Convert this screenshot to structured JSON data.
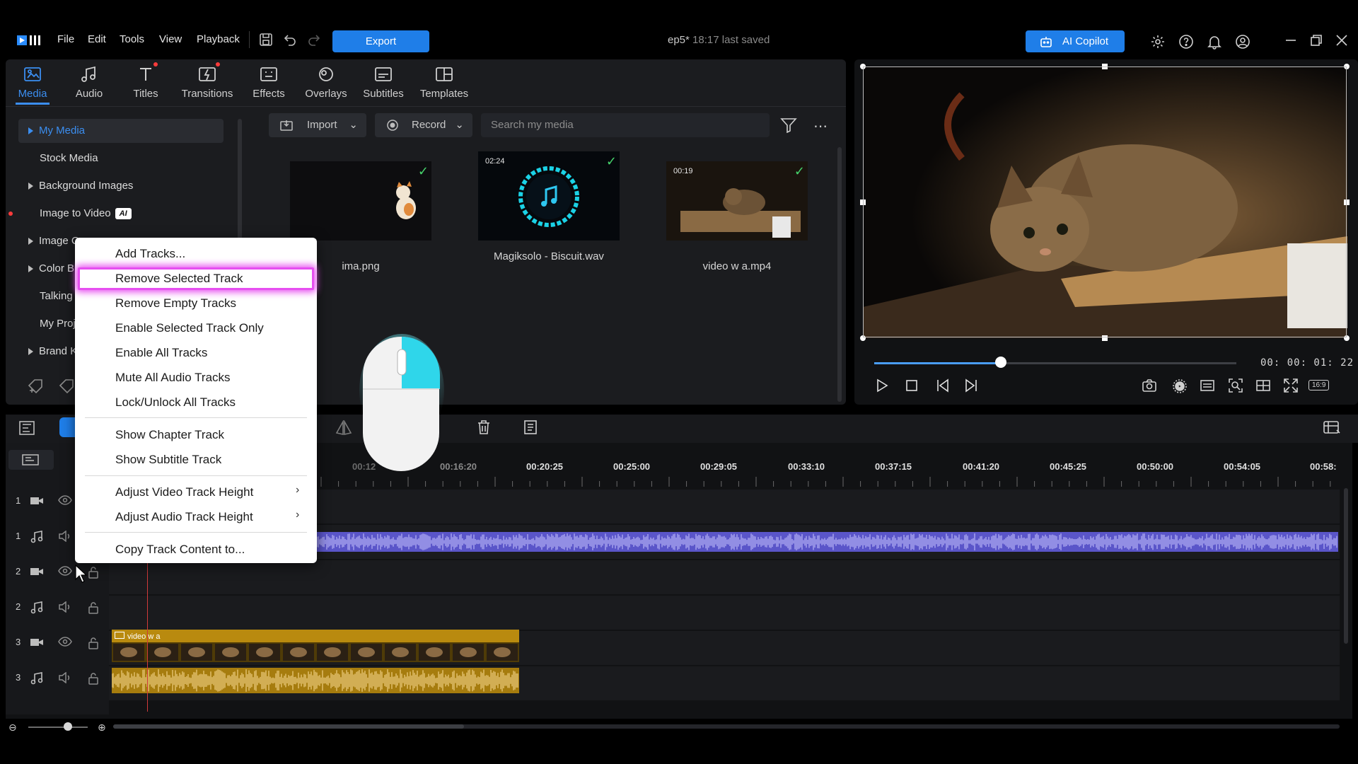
{
  "menubar": {
    "items": [
      "File",
      "Edit",
      "Tools",
      "View",
      "Playback"
    ],
    "export_label": "Export",
    "project_name": "ep5*",
    "save_status": "18:17 last saved",
    "ai_copilot_label": "AI Copilot"
  },
  "tabs": [
    {
      "label": "Media",
      "active": true
    },
    {
      "label": "Audio"
    },
    {
      "label": "Titles"
    },
    {
      "label": "Transitions"
    },
    {
      "label": "Effects"
    },
    {
      "label": "Overlays"
    },
    {
      "label": "Subtitles"
    },
    {
      "label": "Templates"
    }
  ],
  "tree": {
    "my_media": "My Media",
    "stock_media": "Stock Media",
    "background_images": "Background Images",
    "image_to_video": "Image to Video",
    "ai_badge": "AI",
    "image_partial": "Image C",
    "color_partial": "Color B",
    "talking_partial": "Talking",
    "myproj_partial": "My Proj",
    "brand_partial": "Brand K"
  },
  "media_toolbar": {
    "import_label": "Import",
    "record_label": "Record",
    "search_placeholder": "Search my media"
  },
  "media": [
    {
      "name": "ima.png",
      "duration": ""
    },
    {
      "name": "Magiksolo - Biscuit.wav",
      "duration": "02:24"
    },
    {
      "name": "video w a.mp4",
      "duration": "00:19"
    }
  ],
  "preview": {
    "timecode": "00: 00: 01: 22",
    "progress": 0.35,
    "aspect_label": "16:9"
  },
  "timeline": {
    "ruler_labels": [
      "00:12",
      "00:16:20",
      "00:20:25",
      "00:25:00",
      "00:29:05",
      "00:33:10",
      "00:37:15",
      "00:41:20",
      "00:45:25",
      "00:50:00",
      "00:54:05",
      "00:58:"
    ],
    "tracks": [
      {
        "num": "1",
        "kind": "video"
      },
      {
        "num": "1",
        "kind": "audio"
      },
      {
        "num": "2",
        "kind": "video"
      },
      {
        "num": "2",
        "kind": "audio"
      },
      {
        "num": "3",
        "kind": "video"
      },
      {
        "num": "3",
        "kind": "audio"
      }
    ],
    "video_clip_label": "video w a"
  },
  "context_menu": {
    "items": [
      "Add Tracks...",
      "Remove Selected Track",
      "Remove Empty Tracks",
      "Enable Selected Track Only",
      "Enable All Tracks",
      "Mute All Audio Tracks",
      "Lock/Unlock All Tracks",
      "Show Chapter Track",
      "Show Subtitle Track",
      "Adjust Video Track Height",
      "Adjust Audio Track Height",
      "Copy Track Content to..."
    ],
    "highlighted": "Remove Selected Track",
    "highlight_color": "#e64ff0"
  },
  "colors": {
    "accent": "#1f7ee8",
    "check": "#46d36b",
    "audio_clip": "#5a55c9",
    "video_clip": "#b98a0f"
  }
}
